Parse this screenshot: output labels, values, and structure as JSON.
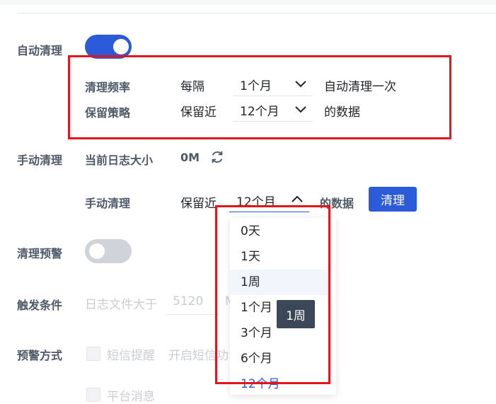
{
  "auto_clean": {
    "label": "自动清理",
    "frequency": {
      "label": "清理频率",
      "prefix": "每隔",
      "value": "1个月",
      "suffix": "自动清理一次"
    },
    "retention": {
      "label": "保留策略",
      "prefix": "保留近",
      "value": "12个月",
      "suffix": "的数据"
    }
  },
  "manual_clean": {
    "label": "手动清理",
    "log_size_label": "当前日志大小",
    "log_size_value": "0M",
    "row_label": "手动清理",
    "retention_prefix": "保留近",
    "retention_value": "12个月",
    "retention_suffix": "的数据",
    "button_label": "清理"
  },
  "warning": {
    "label": "清理预警"
  },
  "trigger": {
    "label": "触发条件",
    "text": "日志文件大于",
    "value": "5120",
    "unit_partial": "M"
  },
  "warning_method": {
    "label": "预警方式",
    "sms_label": "短信提醒",
    "sms_desc_partial": "开启短信功",
    "platform_partial": "平台消息"
  },
  "dropdown": {
    "options": [
      "0天",
      "1天",
      "1周",
      "1个月",
      "3个月",
      "6个月",
      "12个月"
    ],
    "hovered": "1周",
    "selected": "12个月"
  },
  "tooltip": {
    "text": "1周"
  },
  "colors": {
    "primary": "#2c5bd9",
    "annotation_red": "#e3141b"
  },
  "icons": {
    "refresh": "refresh-icon",
    "chevron_down": "chevron-down-icon",
    "chevron_up": "chevron-up-icon"
  }
}
